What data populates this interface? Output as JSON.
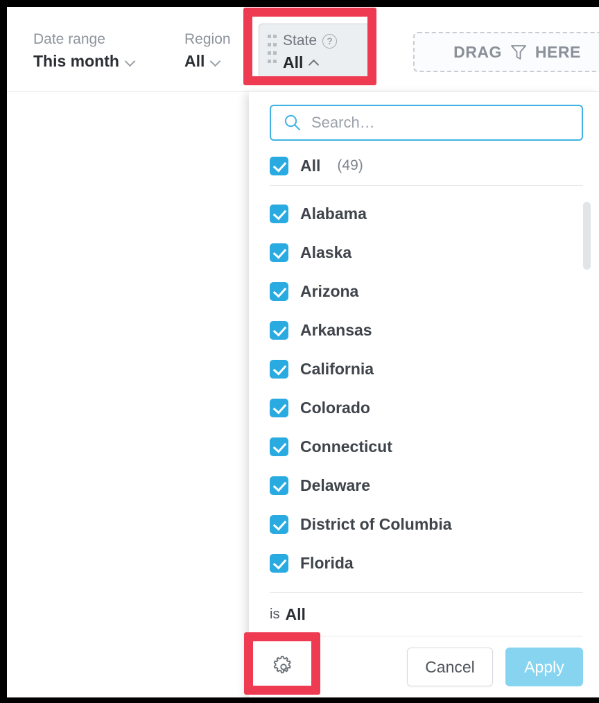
{
  "filter_bar": {
    "filters": [
      {
        "label": "Date range",
        "value": "This month",
        "chevron": "chevron-down-icon"
      },
      {
        "label": "Region",
        "value": "All",
        "chevron": "chevron-down-icon"
      }
    ],
    "active_filter": {
      "label": "State",
      "value": "All",
      "help_icon": "?",
      "chevron": "chevron-up-icon",
      "drag_handle": "drag-handle-icon"
    },
    "dropzone": {
      "text_left": "DRAG",
      "text_right": "HERE",
      "icon": "funnel-icon"
    }
  },
  "dropdown": {
    "search": {
      "placeholder": "Search…",
      "value": "",
      "icon": "search-icon"
    },
    "select_all": {
      "label": "All",
      "count": "(49)",
      "checked": true
    },
    "options": [
      {
        "label": "Alabama",
        "checked": true
      },
      {
        "label": "Alaska",
        "checked": true
      },
      {
        "label": "Arizona",
        "checked": true
      },
      {
        "label": "Arkansas",
        "checked": true
      },
      {
        "label": "California",
        "checked": true
      },
      {
        "label": "Colorado",
        "checked": true
      },
      {
        "label": "Connecticut",
        "checked": true
      },
      {
        "label": "Delaware",
        "checked": true
      },
      {
        "label": "District of Columbia",
        "checked": true
      },
      {
        "label": "Florida",
        "checked": true
      }
    ],
    "summary": {
      "prefix": "is",
      "value": "All"
    },
    "footer": {
      "settings_icon": "gear-icon",
      "cancel_label": "Cancel",
      "apply_label": "Apply"
    }
  },
  "colors": {
    "accent_blue": "#29abe2",
    "apply_blue": "#87d4f0",
    "highlight_red": "#ee3b52",
    "text_dark": "#3f444b",
    "text_muted": "#8d939b"
  }
}
